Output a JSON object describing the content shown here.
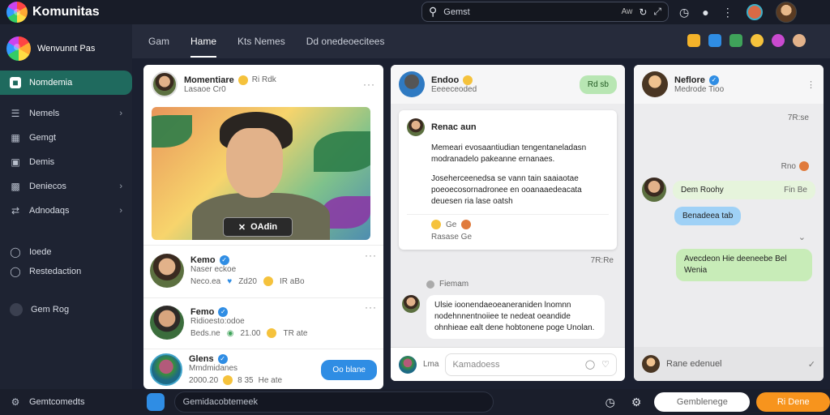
{
  "app": {
    "title": "Komunitas",
    "brand_accent": "#1f6a5e"
  },
  "search": {
    "placeholder": "Gemst",
    "tag": "Aw"
  },
  "sidebar": {
    "header": "Wenvunnt Pas",
    "items": [
      {
        "label": "Nomdemia",
        "icon": "chat-icon",
        "active": true
      },
      {
        "label": "Nemels",
        "icon": "list-icon",
        "chevron": true
      },
      {
        "label": "Gemgt",
        "icon": "table-icon"
      },
      {
        "label": "Demis",
        "icon": "image-icon"
      },
      {
        "label": "Deniecos",
        "icon": "message-icon",
        "chevron": true
      },
      {
        "label": "Adnodaqs",
        "icon": "link-icon",
        "chevron": true
      }
    ],
    "secondary": [
      {
        "label": "Ioede",
        "icon": "help-icon"
      },
      {
        "label": "Restedaction",
        "icon": "history-icon"
      },
      {
        "label": "Gem Rog",
        "icon": "user-icon"
      }
    ],
    "footer": "Gemtcomedts"
  },
  "tabs": [
    "Gam",
    "Hame",
    "Kts   Nemes",
    "Dd onedeoecitees"
  ],
  "active_tab": 1,
  "feed": {
    "post": {
      "name": "Momentiare",
      "meta": "Ri  Rdk",
      "sub": "Lasaoe Cr0",
      "hero_label": "OAdin"
    },
    "people": [
      {
        "name": "Kemo",
        "sub": "Naser eckoe",
        "stat1": "Neco.ea",
        "stat2": "Zd20",
        "stat3": "IR aBo"
      },
      {
        "name": "Femo",
        "sub": "Ridioesto:odoe",
        "stat1": "Beds.ne",
        "stat2": "21.00",
        "stat3": "TR ate"
      },
      {
        "name": "Glens",
        "sub": "Mmdmidanes",
        "stat1": "2000.20",
        "stat2": "8  35",
        "stat3": "He ate",
        "action": "Oo blane"
      }
    ]
  },
  "thread": {
    "name": "Endoo",
    "sub": "Eeeeceoded",
    "pill": "Rd sb",
    "card_name": "Renac aun",
    "card_text_1": "Memeari evosaantiudian tengentaneladasn modranadelo pakeanne ernanaes.",
    "card_text_2": "Joseherceenedsa se vann tain saaiaotae poeoecosornadronee en ooanaaedeacata deuesen ria lase oatsh",
    "card_meta": "Ge",
    "card_meta2": "Rasase Ge",
    "time1": "7R:Re",
    "system": "Fiemam",
    "reply_text": "Ulsie ioonendaeoeaneraniden lnomnn nodehnnentnoiiee te nedeat oeandide ohnhieae ealt dene hobtonene poge Unolan.",
    "input_left": "Lma",
    "input_placeholder": "Kamadoess"
  },
  "chat": {
    "name": "Neflore",
    "sub": "Medrode Tioo",
    "t1": "7R:se",
    "t2": "Rno",
    "msg1": "Dem Roohy",
    "msg1_time": "Fin Be",
    "msg2": "Benadeea tab",
    "msg3": "Avecdeon Hie deeneebe Bel Wenia",
    "input_placeholder": "Rane edenuel"
  },
  "bottom": {
    "placeholder": "Gemidacobtemeek",
    "field2": "Gemblenege",
    "button": "Ri Dene"
  }
}
